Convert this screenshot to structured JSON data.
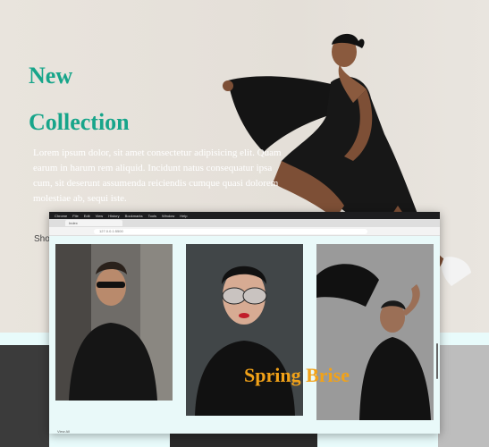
{
  "hero": {
    "title_line1": "New",
    "title_line2": "Collection",
    "body": "Lorem ipsum dolor, sit amet consectetur adipisicing elit. Quam earum in harum rem aliquid. Incidunt natus consequatur ipsa cum, sit deserunt assumenda reiciendis cumque quasi dolorem molestiae ab, sequi iste.",
    "shop_label": "Shop"
  },
  "browser": {
    "menu": [
      "Chrome",
      "File",
      "Edit",
      "View",
      "History",
      "Bookmarks",
      "Tools",
      "Window",
      "Help"
    ],
    "tab_label": "Index",
    "url": "127.0.0.1:5500",
    "overlay_text": "Spring Brise",
    "view_all": "View All"
  },
  "colors": {
    "accent_green": "#17a58a",
    "accent_orange": "#f2a218",
    "band_bg": "#e8fbfb"
  }
}
